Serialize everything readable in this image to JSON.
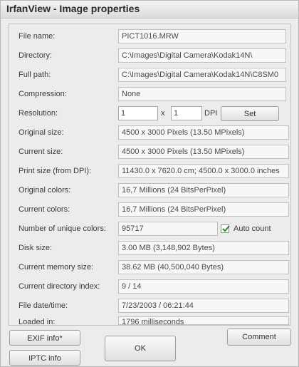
{
  "window": {
    "title": "IrfanView - Image properties"
  },
  "fields": {
    "file_name": {
      "label": "File name:",
      "value": "PICT1016.MRW"
    },
    "directory": {
      "label": "Directory:",
      "value": "C:\\Images\\Digital Camera\\Kodak14N\\"
    },
    "full_path": {
      "label": "Full path:",
      "value": "C:\\Images\\Digital Camera\\Kodak14N\\C8SM0"
    },
    "compression": {
      "label": "Compression:",
      "value": "None"
    },
    "resolution": {
      "label": "Resolution:",
      "x_value": "1",
      "y_value": "1",
      "separator": "x",
      "unit": "DPI",
      "set_label": "Set"
    },
    "original_size": {
      "label": "Original size:",
      "value": "4500 x 3000  Pixels (13.50 MPixels)"
    },
    "current_size": {
      "label": "Current size:",
      "value": "4500 x 3000  Pixels (13.50 MPixels)"
    },
    "print_size": {
      "label": "Print size (from DPI):",
      "value": "11430.0 x 7620.0 cm; 4500.0 x 3000.0 inches"
    },
    "original_colors": {
      "label": "Original colors:",
      "value": "16,7 Millions  (24 BitsPerPixel)"
    },
    "current_colors": {
      "label": "Current colors:",
      "value": "16,7 Millions  (24 BitsPerPixel)"
    },
    "unique_colors": {
      "label": "Number of unique colors:",
      "value": "95717",
      "auto_count_label": "Auto count",
      "auto_count_checked": true
    },
    "disk_size": {
      "label": "Disk size:",
      "value": "3.00 MB (3,148,902 Bytes)"
    },
    "memory_size": {
      "label": "Current memory size:",
      "value": "38.62  MB (40,500,040 Bytes)"
    },
    "directory_index": {
      "label": "Current directory index:",
      "value": "9  /  14"
    },
    "file_datetime": {
      "label": "File date/time:",
      "value": "7/23/2003 / 06:21:44"
    },
    "loaded_in": {
      "label": "Loaded in:",
      "value": "1796 milliseconds"
    }
  },
  "buttons": {
    "exif": "EXIF info*",
    "iptc": "IPTC info",
    "ok": "OK",
    "comment": "Comment"
  },
  "colors": {
    "background": "#ececec",
    "field": "#f7f7f7",
    "check": "#2e8b2e"
  }
}
